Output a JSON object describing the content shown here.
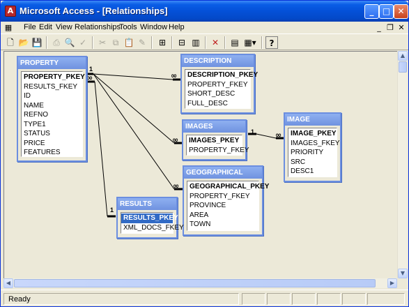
{
  "window": {
    "title": "Microsoft Access - [Relationships]",
    "app_icon_glyph": "A"
  },
  "menu": {
    "items": [
      {
        "id": "file",
        "label": "File"
      },
      {
        "id": "edit",
        "label": "Edit"
      },
      {
        "id": "view",
        "label": "View"
      },
      {
        "id": "relationships",
        "label": "Relationships"
      },
      {
        "id": "tools",
        "label": "Tools"
      },
      {
        "id": "window",
        "label": "Window"
      },
      {
        "id": "help",
        "label": "Help"
      }
    ]
  },
  "toolbar": {
    "icons": [
      "new-icon",
      "open-icon",
      "save-icon",
      "print-icon",
      "print-preview-icon",
      "spelling-icon",
      "cut-icon",
      "copy-icon",
      "paste-icon",
      "format-painter-icon",
      "show-table-icon",
      "show-direct-icon",
      "show-all-icon",
      "delete-icon",
      "database-window-icon",
      "new-object-icon",
      "help-icon"
    ]
  },
  "tables": {
    "property": {
      "name": "PROPERTY",
      "fields": [
        "PROPERTY_PKEY",
        "RESULTS_FKEY",
        "ID",
        "NAME",
        "REFNO",
        "TYPE1",
        "STATUS",
        "PRICE",
        "FEATURES"
      ]
    },
    "description": {
      "name": "DESCRIPTION",
      "fields": [
        "DESCRIPTION_PKEY",
        "PROPERTY_FKEY",
        "SHORT_DESC",
        "FULL_DESC"
      ]
    },
    "images": {
      "name": "IMAGES",
      "fields": [
        "IMAGES_PKEY",
        "PROPERTY_FKEY"
      ]
    },
    "image": {
      "name": "IMAGE",
      "fields": [
        "IMAGE_PKEY",
        "IMAGES_FKEY",
        "PRIORITY",
        "SRC",
        "DESC1"
      ]
    },
    "geographical": {
      "name": "GEOGRAPHICAL",
      "fields": [
        "GEOGRAPHICAL_PKEY",
        "PROPERTY_FKEY",
        "PROVINCE",
        "AREA",
        "TOWN"
      ]
    },
    "results": {
      "name": "RESULTS",
      "fields": [
        "RESULTS_PKEY",
        "XML_DOCS_FKEY"
      ]
    }
  },
  "relationship_labels": {
    "one": "1",
    "many": "∞"
  },
  "colors": {
    "title_bar": "#0450d8",
    "table_header": "#7a9be6",
    "selection": "#316ac5"
  },
  "status": {
    "text": "Ready"
  }
}
